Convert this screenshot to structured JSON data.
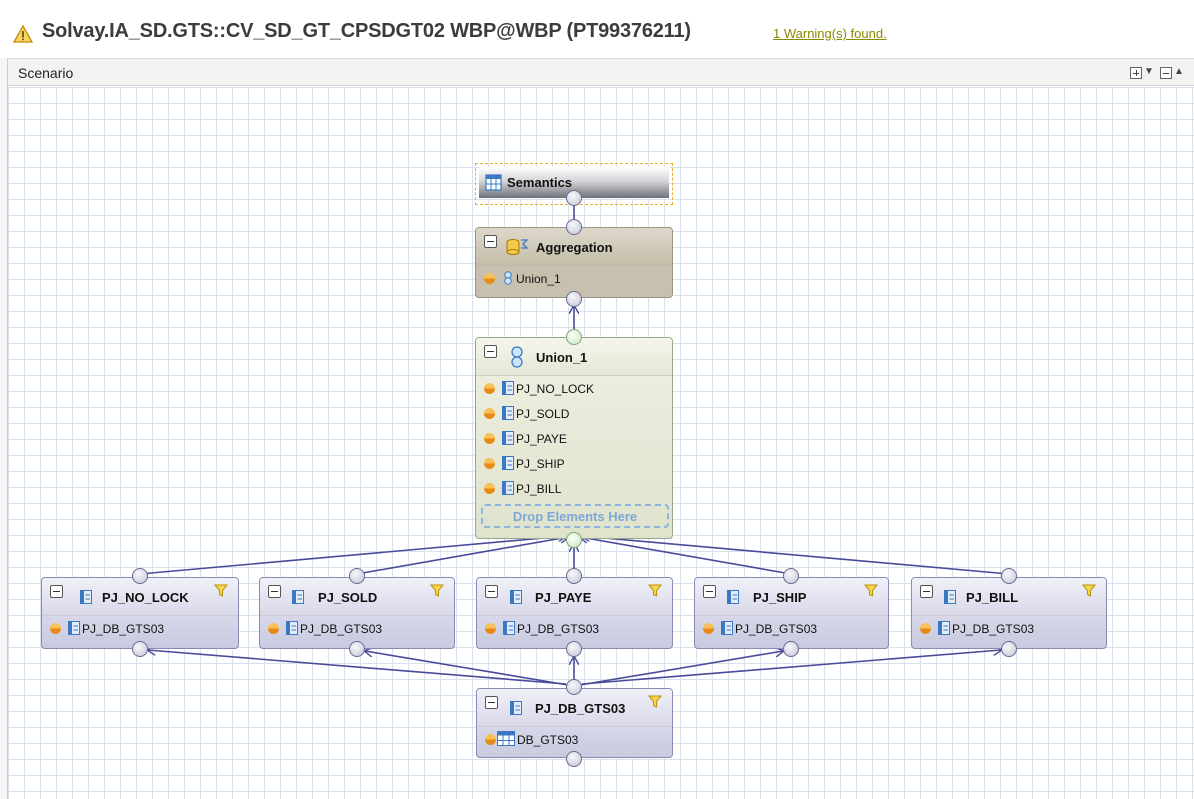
{
  "header": {
    "title": "Solvay.IA_SD.GTS::CV_SD_GT_CPSDGT02 WBP@WBP (PT99376211)",
    "warning_link": "1 Warning(s) found.",
    "warning_icon": "warning-triangle-icon"
  },
  "scenario": {
    "label": "Scenario",
    "expand_all_icon": "expand-all-icon",
    "collapse_all_icon": "collapse-all-icon"
  },
  "nodes": {
    "semantics": {
      "title": "Semantics"
    },
    "aggregation": {
      "title": "Aggregation",
      "inputs": [
        "Union_1"
      ]
    },
    "union": {
      "title": "Union_1",
      "inputs": [
        "PJ_NO_LOCK",
        "PJ_SOLD",
        "PJ_PAYE",
        "PJ_SHIP",
        "PJ_BILL"
      ],
      "drop_text": "Drop Elements Here"
    },
    "projections": [
      {
        "title": "PJ_NO_LOCK",
        "input": "PJ_DB_GTS03"
      },
      {
        "title": "PJ_SOLD",
        "input": "PJ_DB_GTS03"
      },
      {
        "title": "PJ_PAYE",
        "input": "PJ_DB_GTS03"
      },
      {
        "title": "PJ_SHIP",
        "input": "PJ_DB_GTS03"
      },
      {
        "title": "PJ_BILL",
        "input": "PJ_DB_GTS03"
      }
    ],
    "base": {
      "title": "PJ_DB_GTS03",
      "input": "DB_GTS03"
    }
  },
  "colors": {
    "accent_warning": "#8a8a00",
    "connector": "#4a4a9a",
    "grid": "#d7e2ee"
  }
}
